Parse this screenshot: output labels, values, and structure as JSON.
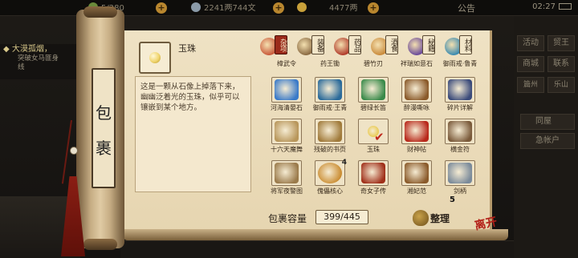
{
  "hud": {
    "left_stat": "5/280",
    "silver": "2241两744文",
    "gold": "4477两",
    "announce": "公告",
    "clock": "02:27",
    "quest_title": "大漠孤烟，",
    "quest_desc": "突破女马匪身",
    "quest_desc2": "线",
    "right_buttons": [
      "活动",
      "贸王",
      "商城",
      "联系"
    ],
    "map_tabs": [
      "篇州",
      "乐山"
    ],
    "side_buttons": [
      "同屋",
      "急帐户"
    ]
  },
  "scroll": {
    "label_chars": [
      "包",
      "裹"
    ]
  },
  "detail": {
    "item_name": "玉珠",
    "description": "这是一颗从石像上掉落下来，幽幽泛着光的玉珠，似乎可以镶嵌到某个地方。"
  },
  "tabs": [
    {
      "label": "杂项",
      "active": true,
      "color": "#c9593a"
    },
    {
      "label": "装备",
      "active": false,
      "color": "#8a6a42"
    },
    {
      "label": "药品",
      "active": false,
      "color": "#b03a2a"
    },
    {
      "label": "酒食",
      "active": false,
      "color": "#c98a3a"
    },
    {
      "label": "秘籍",
      "active": false,
      "color": "#6a4a9a"
    },
    {
      "label": "材料",
      "active": false,
      "color": "#3a8ab0"
    }
  ],
  "grid_top_labels": [
    "樟武令",
    "药王锄",
    "碧竹刃",
    "祥瑞如意石",
    "御雨戒·鲁青"
  ],
  "grid": [
    [
      {
        "label": "河海清晏石",
        "icon": "blue-crystal",
        "color": "#3a7ac8"
      },
      {
        "label": "御雨戒·王青",
        "icon": "jade-ring",
        "color": "#2a6a9a"
      },
      {
        "label": "碧绿长笛",
        "icon": "green-flute",
        "color": "#3a8a4a"
      },
      {
        "label": "醉漫嘶咏",
        "icon": "scroll-book",
        "color": "#8a5a2a"
      },
      {
        "label": "碎片详解",
        "icon": "blue-book",
        "color": "#3a4a7a"
      }
    ],
    [
      {
        "label": "十六天魔舞",
        "icon": "map-scroll",
        "color": "#b8965a"
      },
      {
        "label": "残破的书页",
        "icon": "torn-page",
        "color": "#a07a3a"
      },
      {
        "label": "玉珠",
        "icon": "pearl",
        "color": "#e8c84a",
        "checked": true
      },
      {
        "label": "财神帖",
        "icon": "red-card",
        "color": "#b8281a"
      },
      {
        "label": "横金符",
        "icon": "gold-charm",
        "color": "#7a5a3a"
      }
    ],
    [
      {
        "label": "将军夜警图",
        "icon": "painting",
        "color": "#9a7a4a"
      },
      {
        "label": "傀儡核心",
        "icon": "core-sphere",
        "color": "#c8882a",
        "count": "4"
      },
      {
        "label": "奇女子传",
        "icon": "red-book",
        "color": "#a0301a"
      },
      {
        "label": "湘妃范",
        "icon": "brown-book",
        "color": "#8a5a2a"
      },
      {
        "label": "剑柄",
        "icon": "sword-hilt",
        "color": "#7a8a9a"
      }
    ]
  ],
  "page_marker": "5",
  "footer": {
    "capacity_label": "包裹容量",
    "capacity_value": "399/445",
    "sort_label": "整理",
    "close_label": "离开"
  }
}
